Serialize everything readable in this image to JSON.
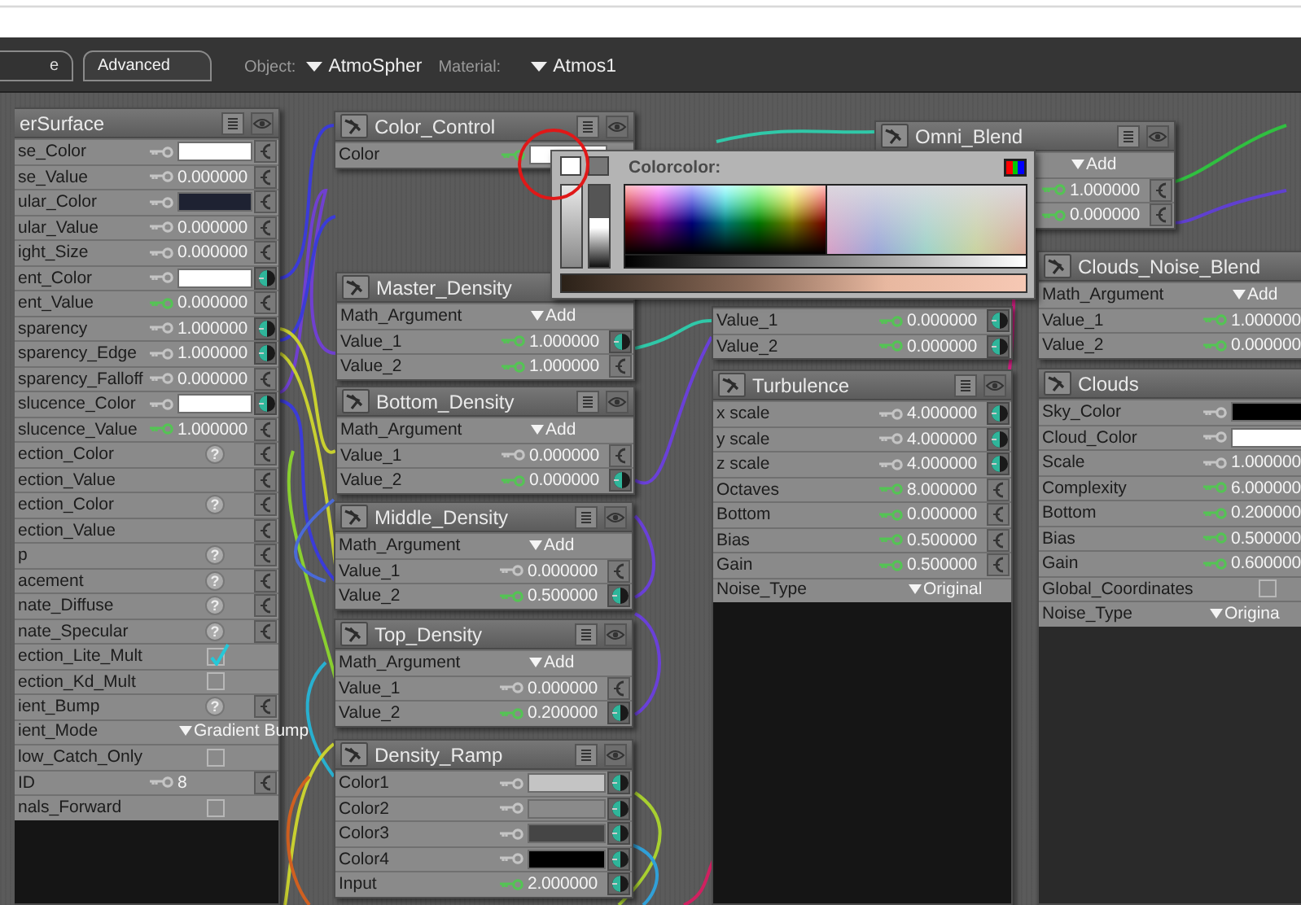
{
  "toolbar": {
    "tabs": [
      {
        "label": "e",
        "selected": false
      },
      {
        "label": "Advanced",
        "selected": true
      }
    ],
    "object": {
      "label": "Object:",
      "value": "AtmoSpher"
    },
    "material": {
      "label": "Material:",
      "value": "Atmos1"
    }
  },
  "nodes": [
    {
      "title": "erSurface",
      "kind": "panel",
      "rows": [
        {
          "label": "se_Color",
          "kind": "color",
          "color": "#ffffff",
          "keyed": false,
          "connected": false
        },
        {
          "label": "se_Value",
          "kind": "number",
          "value": "0.000000",
          "keyed": false,
          "connected": false
        },
        {
          "label": "ular_Color",
          "kind": "color",
          "color": "#1e2232",
          "keyed": false,
          "connected": false
        },
        {
          "label": "ular_Value",
          "kind": "number",
          "value": "0.000000",
          "keyed": false,
          "connected": false
        },
        {
          "label": "ight_Size",
          "kind": "number",
          "value": "0.000000",
          "keyed": false,
          "connected": false
        },
        {
          "label": "ent_Color",
          "kind": "color",
          "color": "#ffffff",
          "keyed": false,
          "connected": true
        },
        {
          "label": "ent_Value",
          "kind": "number",
          "value": "0.000000",
          "keyed": true,
          "connected": false
        },
        {
          "label": "sparency",
          "kind": "number",
          "value": "1.000000",
          "keyed": false,
          "connected": true
        },
        {
          "label": "sparency_Edge",
          "kind": "number",
          "value": "1.000000",
          "keyed": false,
          "connected": true
        },
        {
          "label": "sparency_Falloff",
          "kind": "number",
          "value": "0.000000",
          "keyed": false,
          "connected": false
        },
        {
          "label": "slucence_Color",
          "kind": "color",
          "color": "#ffffff",
          "keyed": false,
          "connected": true
        },
        {
          "label": "slucence_Value",
          "kind": "number",
          "value": "1.000000",
          "keyed": true,
          "connected": false
        },
        {
          "label": "ection_Color",
          "kind": "query",
          "value": "?",
          "connected": false
        },
        {
          "label": "ection_Value",
          "kind": "none",
          "connected": false
        },
        {
          "label": "ection_Color",
          "kind": "query",
          "value": "?",
          "connected": false
        },
        {
          "label": "ection_Value",
          "kind": "none",
          "connected": false
        },
        {
          "label": "p",
          "kind": "query",
          "value": "?",
          "connected": false
        },
        {
          "label": "acement",
          "kind": "query",
          "value": "?",
          "connected": false
        },
        {
          "label": "nate_Diffuse",
          "kind": "query",
          "value": "?",
          "connected": false
        },
        {
          "label": "nate_Specular",
          "kind": "query",
          "value": "?",
          "connected": false
        },
        {
          "label": "ection_Lite_Mult",
          "kind": "check",
          "checked": true
        },
        {
          "label": "ection_Kd_Mult",
          "kind": "check",
          "checked": false
        },
        {
          "label": "ient_Bump",
          "kind": "query",
          "value": "?",
          "connected": false
        },
        {
          "label": "ient_Mode",
          "kind": "menu",
          "value": "Gradient Bump"
        },
        {
          "label": "low_Catch_Only",
          "kind": "check",
          "checked": false
        },
        {
          "label": "ID",
          "kind": "number",
          "value": "8",
          "keyed": false,
          "connected": false
        },
        {
          "label": "nals_Forward",
          "kind": "check",
          "checked": false
        }
      ]
    },
    {
      "title": "Color_Control",
      "kind": "node",
      "rows": [
        {
          "label": "Color",
          "kind": "color",
          "color": "#ffffff",
          "keyed": true
        }
      ]
    },
    {
      "title": "Omni_Blend",
      "kind": "node",
      "rows": [
        {
          "kind": "menu",
          "value": "Add"
        },
        {
          "kind": "number",
          "value": "1.000000",
          "keyed": true,
          "connected": false
        },
        {
          "kind": "number",
          "value": "0.000000",
          "keyed": true,
          "connected": false
        }
      ]
    },
    {
      "title": "Master_Density",
      "kind": "node",
      "rows": [
        {
          "label": "Math_Argument",
          "kind": "menu",
          "value": "Add"
        },
        {
          "label": "Value_1",
          "kind": "number",
          "value": "1.000000",
          "keyed": true,
          "connected": true
        },
        {
          "label": "Value_2",
          "kind": "number",
          "value": "1.000000",
          "keyed": true,
          "connected": false
        }
      ]
    },
    {
      "kind": "node",
      "rows": [
        {
          "label": "Value_1",
          "kind": "number",
          "value": "0.000000",
          "keyed": true,
          "connected": true
        },
        {
          "label": "Value_2",
          "kind": "number",
          "value": "0.000000",
          "keyed": true,
          "connected": true
        }
      ]
    },
    {
      "title": "Clouds_Noise_Blend",
      "kind": "node",
      "rows": [
        {
          "label": "Math_Argument",
          "kind": "menu",
          "value": "Add"
        },
        {
          "label": "Value_1",
          "kind": "number",
          "value": "1.000000",
          "keyed": true
        },
        {
          "label": "Value_2",
          "kind": "number",
          "value": "0.000000",
          "keyed": true
        }
      ]
    },
    {
      "title": "Bottom_Density",
      "kind": "node",
      "rows": [
        {
          "label": "Math_Argument",
          "kind": "menu",
          "value": "Add"
        },
        {
          "label": "Value_1",
          "kind": "number",
          "value": "0.000000",
          "keyed": false,
          "connected": false
        },
        {
          "label": "Value_2",
          "kind": "number",
          "value": "0.000000",
          "keyed": true,
          "connected": true
        }
      ]
    },
    {
      "title": "Turbulence",
      "kind": "node",
      "rows": [
        {
          "label": "x scale",
          "kind": "number",
          "value": "4.000000",
          "keyed": false,
          "connected": true
        },
        {
          "label": "y scale",
          "kind": "number",
          "value": "4.000000",
          "keyed": false,
          "connected": true
        },
        {
          "label": "z scale",
          "kind": "number",
          "value": "4.000000",
          "keyed": false,
          "connected": true
        },
        {
          "label": "Octaves",
          "kind": "number",
          "value": "8.000000",
          "keyed": true,
          "connected": false
        },
        {
          "label": "Bottom",
          "kind": "number",
          "value": "0.000000",
          "keyed": true,
          "connected": false
        },
        {
          "label": "Bias",
          "kind": "number",
          "value": "0.500000",
          "keyed": true,
          "connected": false
        },
        {
          "label": "Gain",
          "kind": "number",
          "value": "0.500000",
          "keyed": true,
          "connected": false
        },
        {
          "label": "Noise_Type",
          "kind": "menu",
          "value": "Original"
        }
      ]
    },
    {
      "title": "Clouds",
      "kind": "node",
      "rows": [
        {
          "label": "Sky_Color",
          "kind": "color",
          "color": "#000000",
          "keyed": false
        },
        {
          "label": "Cloud_Color",
          "kind": "color",
          "color": "#ffffff",
          "keyed": false
        },
        {
          "label": "Scale",
          "kind": "number",
          "value": "1.000000",
          "keyed": false
        },
        {
          "label": "Complexity",
          "kind": "number",
          "value": "6.000000",
          "keyed": true
        },
        {
          "label": "Bottom",
          "kind": "number",
          "value": "0.200000",
          "keyed": true
        },
        {
          "label": "Bias",
          "kind": "number",
          "value": "0.500000",
          "keyed": true
        },
        {
          "label": "Gain",
          "kind": "number",
          "value": "0.600000",
          "keyed": true
        },
        {
          "label": "Global_Coordinates",
          "kind": "check",
          "checked": false
        },
        {
          "label": "Noise_Type",
          "kind": "menu",
          "value": "Origina"
        }
      ]
    },
    {
      "title": "Middle_Density",
      "kind": "node",
      "rows": [
        {
          "label": "Math_Argument",
          "kind": "menu",
          "value": "Add"
        },
        {
          "label": "Value_1",
          "kind": "number",
          "value": "0.000000",
          "keyed": false,
          "connected": false
        },
        {
          "label": "Value_2",
          "kind": "number",
          "value": "0.500000",
          "keyed": true,
          "connected": true
        }
      ]
    },
    {
      "title": "Top_Density",
      "kind": "node",
      "rows": [
        {
          "label": "Math_Argument",
          "kind": "menu",
          "value": "Add"
        },
        {
          "label": "Value_1",
          "kind": "number",
          "value": "0.000000",
          "keyed": false,
          "connected": false
        },
        {
          "label": "Value_2",
          "kind": "number",
          "value": "0.200000",
          "keyed": true,
          "connected": true
        }
      ]
    },
    {
      "title": "Density_Ramp",
      "kind": "node",
      "rows": [
        {
          "label": "Color1",
          "kind": "color",
          "color": "#c4c4c4",
          "keyed": false,
          "connected": true
        },
        {
          "label": "Color2",
          "kind": "color",
          "color": "#8a8a8a",
          "keyed": false,
          "connected": true
        },
        {
          "label": "Color3",
          "kind": "color",
          "color": "#454545",
          "keyed": false,
          "connected": true
        },
        {
          "label": "Color4",
          "kind": "color",
          "color": "#000000",
          "keyed": false,
          "connected": true
        },
        {
          "label": "Input",
          "kind": "number",
          "value": "2.000000",
          "keyed": true,
          "connected": true
        }
      ]
    }
  ],
  "color_picker": {
    "title": "Colorcolor:",
    "sliders": [
      {
        "level": 1
      },
      {
        "level": 0.6
      }
    ]
  }
}
